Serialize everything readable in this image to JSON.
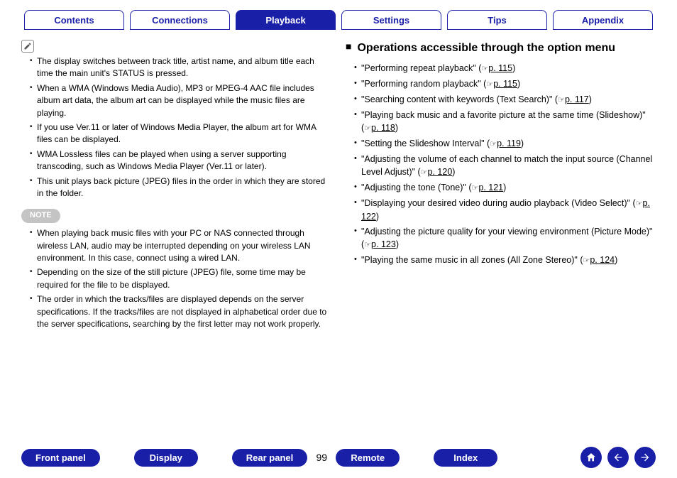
{
  "topnav": {
    "tabs": [
      {
        "label": "Contents",
        "active": false
      },
      {
        "label": "Connections",
        "active": false
      },
      {
        "label": "Playback",
        "active": true
      },
      {
        "label": "Settings",
        "active": false
      },
      {
        "label": "Tips",
        "active": false
      },
      {
        "label": "Appendix",
        "active": false
      }
    ]
  },
  "left": {
    "bullets": [
      "The display switches between track title, artist name, and album title each time the main unit's STATUS is pressed.",
      "When a WMA (Windows Media Audio), MP3 or MPEG-4 AAC file includes album art data, the album art can be displayed while the music files are playing.",
      "If you use Ver.11 or later of Windows Media Player, the album art for WMA files can be displayed.",
      "WMA Lossless files can be played when using a server supporting transcoding, such as Windows Media Player (Ver.11 or later).",
      "This unit plays back picture (JPEG) files in the order in which they are stored in the folder."
    ],
    "note_label": "NOTE",
    "note_bullets": [
      "When playing back music files with your PC or NAS connected through wireless LAN, audio may be interrupted depending on your wireless LAN environment. In this case, connect using a wired LAN.",
      "Depending on the size of the still picture (JPEG) file, some time may be required for the file to be displayed.",
      "The order in which the tracks/files are displayed depends on the server specifications. If the tracks/files are not displayed in alphabetical order due to the server specifications, searching by the first letter may not work properly."
    ]
  },
  "right": {
    "heading": "Operations accessible through the option menu",
    "items": [
      {
        "text": "\"Performing repeat playback\"",
        "page": "p. 115"
      },
      {
        "text": "\"Performing random playback\"",
        "page": "p. 115"
      },
      {
        "text": "\"Searching content with keywords (Text Search)\"",
        "page": "p. 117"
      },
      {
        "text": "\"Playing back music and a favorite picture at the same time (Slideshow)\"",
        "page": "p. 118"
      },
      {
        "text": "\"Setting the Slideshow Interval\"",
        "page": "p. 119"
      },
      {
        "text": "\"Adjusting the volume of each channel to match the input source (Channel Level Adjust)\"",
        "page": "p. 120"
      },
      {
        "text": "\"Adjusting the tone (Tone)\"",
        "page": "p. 121"
      },
      {
        "text": "\"Displaying your desired video during audio playback (Video Select)\"",
        "page": "p. 122"
      },
      {
        "text": "\"Adjusting the picture quality for your viewing environment (Picture Mode)\"",
        "page": "p. 123"
      },
      {
        "text": "\"Playing the same music in all zones (All Zone Stereo)\"",
        "page": "p. 124"
      }
    ]
  },
  "bottomnav": {
    "buttons_left": [
      "Front panel",
      "Display",
      "Rear panel"
    ],
    "page_number": "99",
    "buttons_right": [
      "Remote",
      "Index"
    ]
  }
}
